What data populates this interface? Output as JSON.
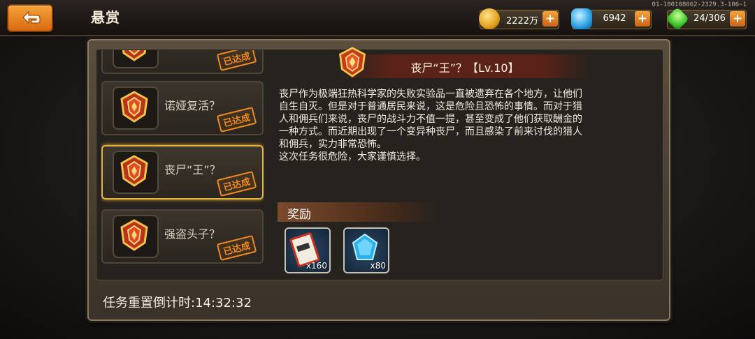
{
  "header": {
    "title": "悬赏",
    "version": "01-100108062-2329.3-106~1"
  },
  "resources": {
    "gold": "2222万",
    "gems": "6942",
    "energy": "24/306"
  },
  "quests": [
    {
      "name": "",
      "status": "已达成",
      "selected": false
    },
    {
      "name": "诺娅复活？",
      "status": "已达成",
      "selected": false
    },
    {
      "name": "丧尸“王”？",
      "status": "已达成",
      "selected": true
    },
    {
      "name": "强盗头子？",
      "status": "已达成",
      "selected": false
    }
  ],
  "detail": {
    "title": "丧尸“王”？【Lv.10】",
    "description": "丧尸作为极端狂热科学家的失败实验品一直被遗弃在各个地方，让他们\n自生自灭。但是对于普通居民来说，这是危险且恐怖的事情。而对于猎\n人和佣兵们来说，丧尸的战斗力不值一提，甚至变成了他们获取酬金的\n一种方式。而近期出现了一个变异种丧尸，而且感染了前来讨伐的猎人\n和佣兵，实力非常恐怖。\n这次任务很危险，大家谨慎选择。",
    "reward_label": "奖励",
    "rewards": [
      {
        "icon": "ticket-icon",
        "count": "x160"
      },
      {
        "icon": "blue-crystal-icon",
        "count": "x80"
      }
    ]
  },
  "footer": {
    "timer": "任务重置倒计时:14:32:32"
  },
  "colors": {
    "accent": "#f08a1e",
    "selected_border": "#e6b43a"
  }
}
